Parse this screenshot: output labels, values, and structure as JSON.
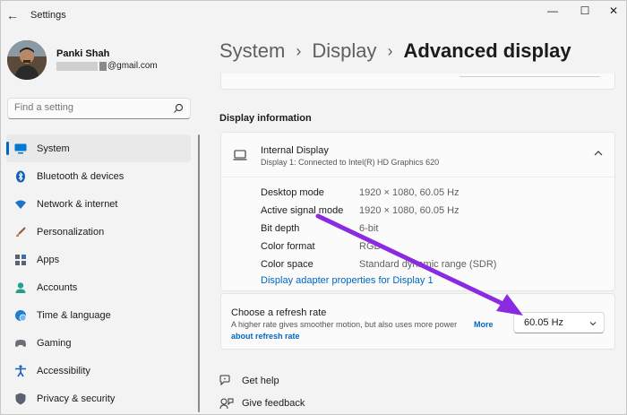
{
  "window": {
    "app_title": "Settings",
    "minimize_glyph": "—",
    "maximize_glyph": "☐",
    "close_glyph": "✕"
  },
  "profile": {
    "name": "Panki Shah",
    "email_suffix": "@gmail.com"
  },
  "search": {
    "placeholder": "Find a setting"
  },
  "sidebar": {
    "items": [
      {
        "label": "System",
        "icon": "monitor-icon",
        "color": "#0078d4",
        "active": true
      },
      {
        "label": "Bluetooth & devices",
        "icon": "bluetooth-icon",
        "color": "#0a5fb5"
      },
      {
        "label": "Network & internet",
        "icon": "wifi-icon",
        "color": "#1a73c9"
      },
      {
        "label": "Personalization",
        "icon": "brush-icon",
        "color": "#d87b3a"
      },
      {
        "label": "Apps",
        "icon": "apps-icon",
        "color": "#5a6272"
      },
      {
        "label": "Accounts",
        "icon": "person-icon",
        "color": "#22a08a"
      },
      {
        "label": "Time & language",
        "icon": "globe-clock-icon",
        "color": "#1e7fd0"
      },
      {
        "label": "Gaming",
        "icon": "gamepad-icon",
        "color": "#6b6f78"
      },
      {
        "label": "Accessibility",
        "icon": "accessibility-icon",
        "color": "#1863b8"
      },
      {
        "label": "Privacy & security",
        "icon": "shield-icon",
        "color": "#5a6272"
      }
    ]
  },
  "breadcrumb": {
    "part1": "System",
    "part2": "Display",
    "current": "Advanced display",
    "separator": "›"
  },
  "section": {
    "title": "Display information"
  },
  "display": {
    "name": "Internal Display",
    "subtitle": "Display 1: Connected to Intel(R) HD Graphics 620",
    "rows": [
      {
        "key": "Desktop mode",
        "value": "1920 × 1080, 60.05 Hz"
      },
      {
        "key": "Active signal mode",
        "value": "1920 × 1080, 60.05 Hz"
      },
      {
        "key": "Bit depth",
        "value": "6-bit"
      },
      {
        "key": "Color format",
        "value": "RGB"
      },
      {
        "key": "Color space",
        "value": "Standard dynamic range (SDR)"
      }
    ],
    "adapter_link": "Display adapter properties for Display 1"
  },
  "refresh_rate": {
    "title": "Choose a refresh rate",
    "description": "A higher rate gives smoother motion, but also uses more power",
    "more_link_1": "More",
    "more_link_2": "about refresh rate",
    "selected": "60.05 Hz"
  },
  "footer": {
    "help": "Get help",
    "feedback": "Give feedback"
  },
  "colors": {
    "accent": "#0067c0",
    "annotation_arrow": "#8a2be2"
  }
}
